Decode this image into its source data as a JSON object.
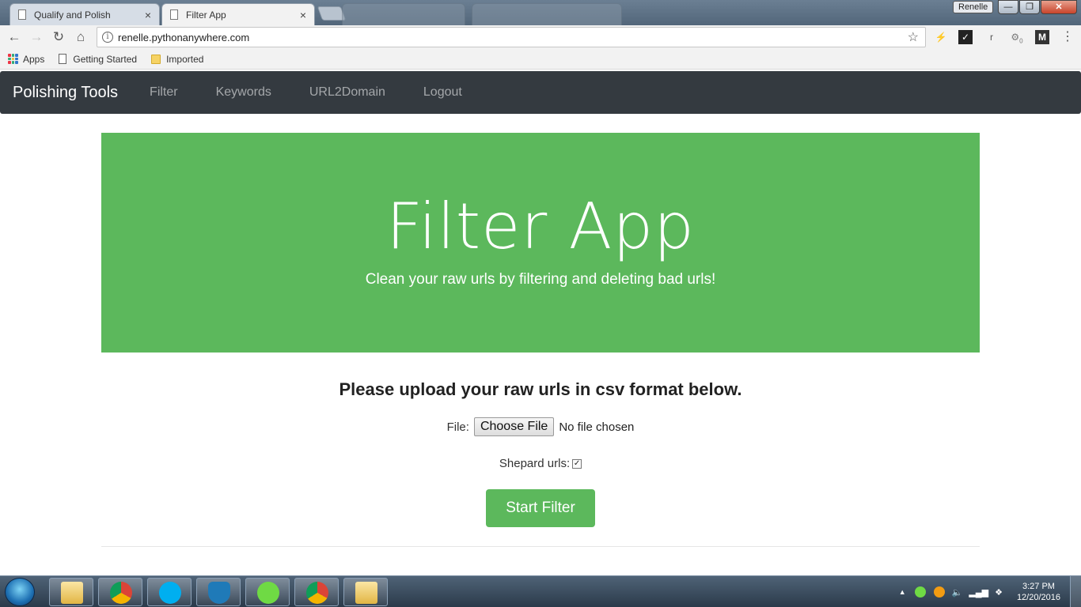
{
  "browser": {
    "tabs": [
      {
        "title": "Qualify and Polish",
        "close": "×"
      },
      {
        "title": "Filter App",
        "close": "×"
      }
    ],
    "profile": "Renelle",
    "window_buttons": {
      "minimize": "—",
      "maximize": "❐",
      "close": "✕"
    },
    "url": "renelle.pythonanywhere.com",
    "bookmarks": [
      "Apps",
      "Getting Started",
      "Imported"
    ],
    "extension_badge": "0"
  },
  "navbar": {
    "brand": "Polishing Tools",
    "links": [
      "Filter",
      "Keywords",
      "URL2Domain",
      "Logout"
    ]
  },
  "jumbotron": {
    "title": "Filter App",
    "subtitle": "Clean your raw urls by filtering and deleting bad urls!"
  },
  "form": {
    "heading": "Please upload your raw urls in csv format below.",
    "file_label": "File:",
    "choose_button": "Choose File",
    "file_status": "No file chosen",
    "checkbox_label": "Shepard urls:",
    "checkbox_checked": true,
    "submit": "Start Filter"
  },
  "taskbar": {
    "time": "3:27 PM",
    "date": "12/20/2016"
  },
  "colors": {
    "jumbotron": "#5cb85c",
    "navbar": "#343a40",
    "button": "#5cb85c"
  }
}
